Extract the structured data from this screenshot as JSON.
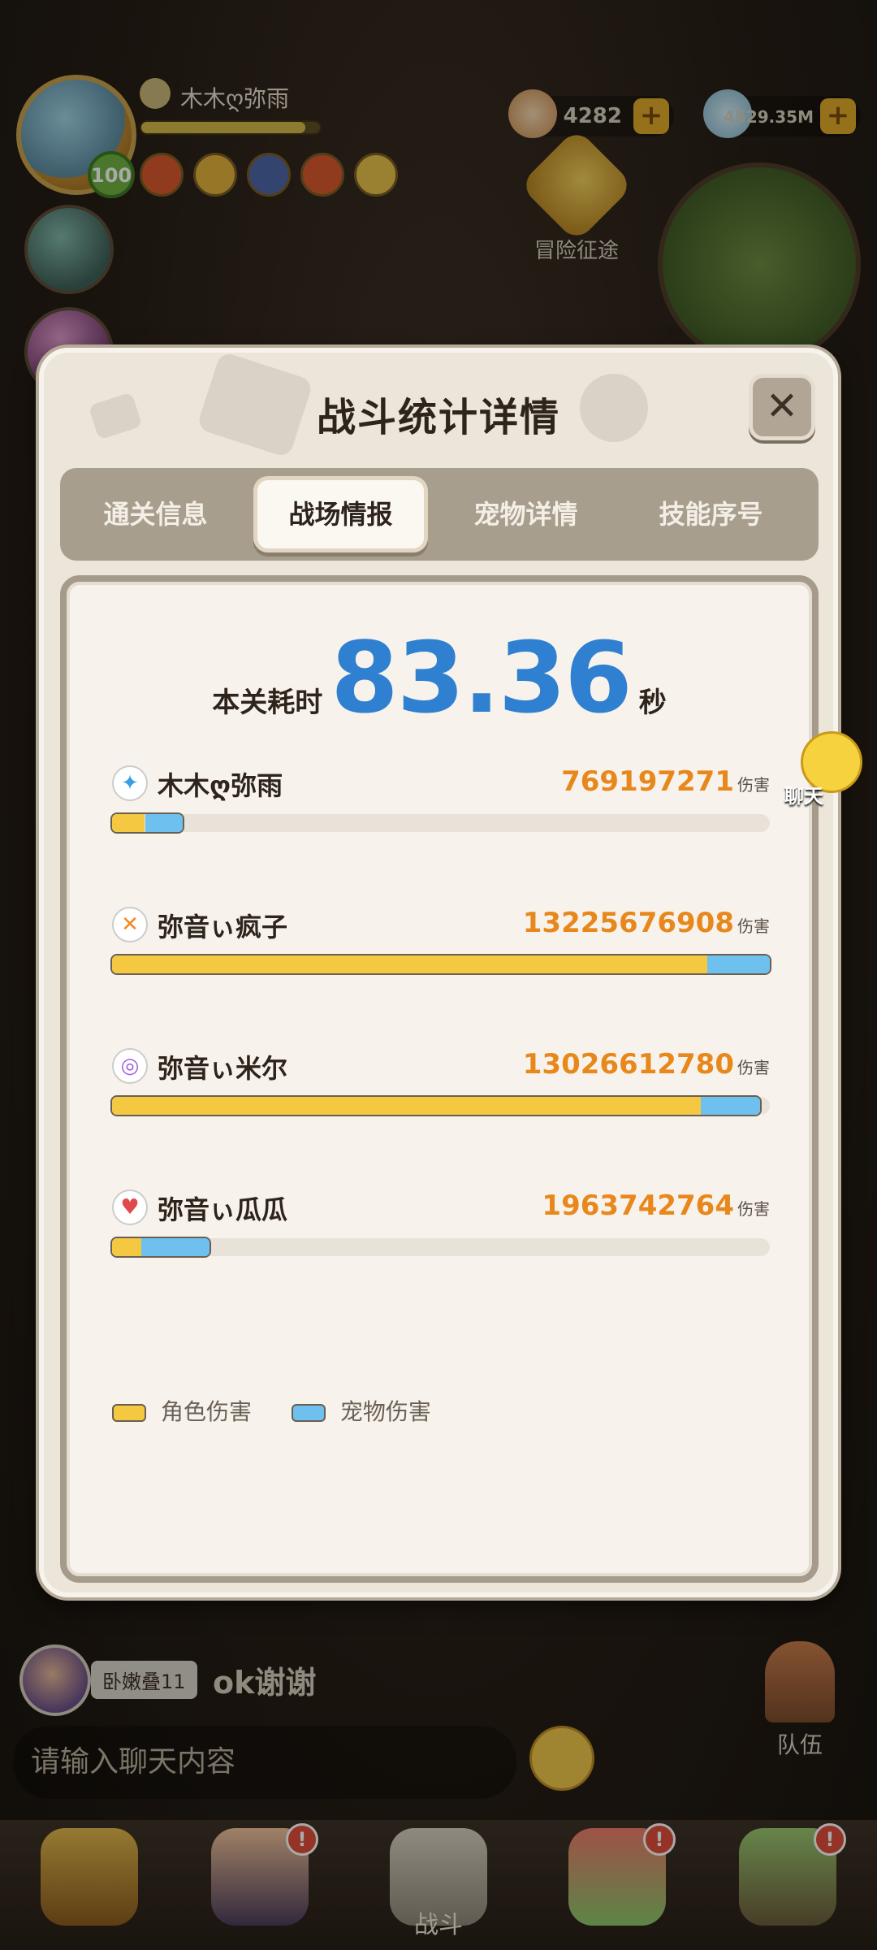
{
  "hud": {
    "player_name": "木木ღ弥雨",
    "level": "100",
    "gold": "4282",
    "gems": "4529.35M",
    "quest_label": "冒险征途",
    "plus_label": "+"
  },
  "chat": {
    "sender": "卧嫩叠11",
    "message": "ok谢谢",
    "input_placeholder": "请输入聊天内容",
    "helper_label": "聊天",
    "team_label": "队伍"
  },
  "bottom_nav": {
    "battle_label": "战斗",
    "badge": "!"
  },
  "modal": {
    "title": "战斗统计详情",
    "close_label": "✕",
    "tabs": [
      {
        "label": "通关信息"
      },
      {
        "label": "战场情报"
      },
      {
        "label": "宠物详情"
      },
      {
        "label": "技能序号"
      }
    ],
    "active_tab": 1,
    "time_label": "本关耗时",
    "time_value": "83.36",
    "time_unit": "秒",
    "damage_unit": "伤害",
    "players": [
      {
        "name": "木木ღ弥雨",
        "damage": "769197271",
        "role_fraction": 0.05,
        "pet_fraction": 0.058,
        "icon": "lightning-swirl-icon",
        "icon_color": "#3a9ee0"
      },
      {
        "name": "弥音ぃ疯子",
        "damage": "13225676908",
        "role_fraction": 0.905,
        "pet_fraction": 0.095,
        "icon": "crossed-blades-icon",
        "icon_color": "#f08a24"
      },
      {
        "name": "弥音ぃ米尔",
        "damage": "13026612780",
        "role_fraction": 0.895,
        "pet_fraction": 0.09,
        "icon": "purple-swirl-icon",
        "icon_color": "#9b5de5"
      },
      {
        "name": "弥音ぃ瓜瓜",
        "damage": "1963742764",
        "role_fraction": 0.045,
        "pet_fraction": 0.103,
        "icon": "red-wings-icon",
        "icon_color": "#e04a4a"
      }
    ],
    "legend": [
      {
        "label": "角色伤害",
        "color": "#f4c840"
      },
      {
        "label": "宠物伤害",
        "color": "#6ec0ef"
      }
    ]
  }
}
